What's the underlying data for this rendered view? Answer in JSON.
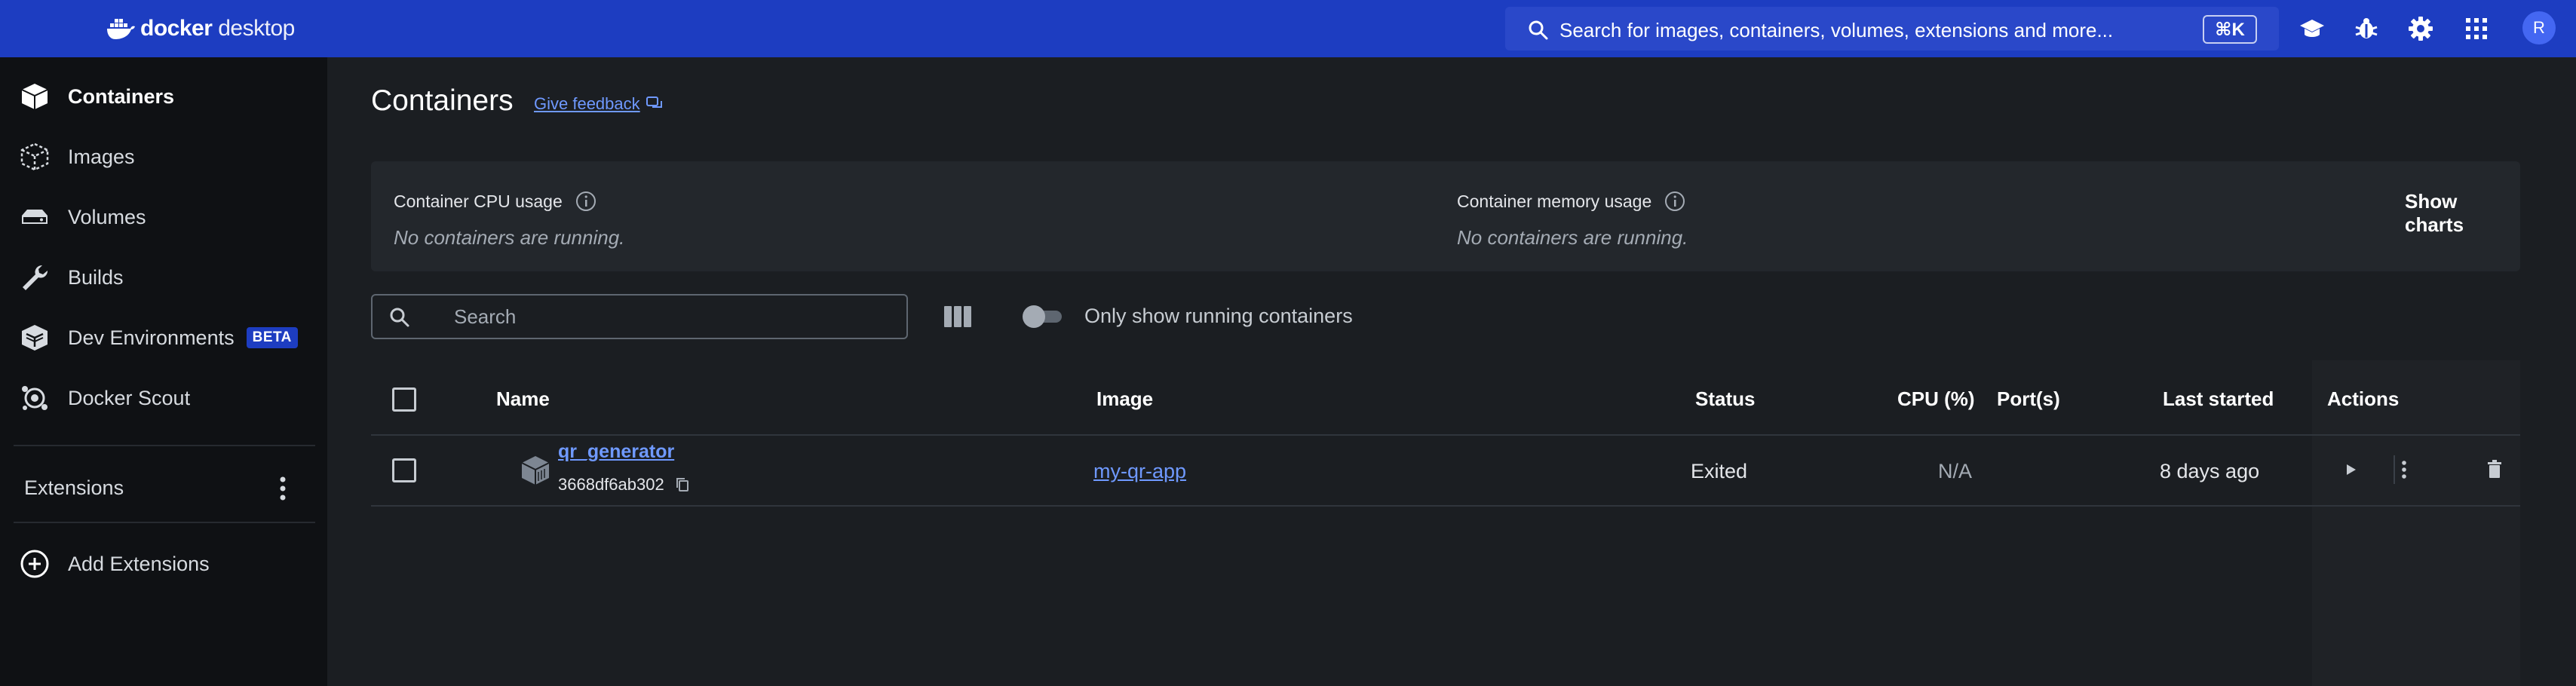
{
  "app": {
    "logo_bold": "docker",
    "logo_light": "desktop"
  },
  "topbar": {
    "search_placeholder": "Search for images, containers, volumes, extensions and more...",
    "shortcut": "⌘K",
    "icons": [
      "search-icon",
      "learning-center-icon",
      "troubleshoot-bug-icon",
      "settings-gear-icon",
      "apps-grid-icon"
    ],
    "avatar_initial": "R"
  },
  "sidebar": {
    "items": [
      {
        "label": "Containers",
        "icon": "containers-icon",
        "active": true
      },
      {
        "label": "Images",
        "icon": "images-icon",
        "active": false
      },
      {
        "label": "Volumes",
        "icon": "volumes-icon",
        "active": false
      },
      {
        "label": "Builds",
        "icon": "builds-wrench-icon",
        "active": false
      },
      {
        "label": "Dev Environments",
        "icon": "dev-environments-icon",
        "active": false,
        "badge": "BETA"
      },
      {
        "label": "Docker Scout",
        "icon": "docker-scout-icon",
        "active": false
      }
    ],
    "extensions_label": "Extensions",
    "add_extensions_label": "Add Extensions"
  },
  "main": {
    "title": "Containers",
    "feedback_label": "Give feedback",
    "stats": {
      "cpu_label": "Container CPU usage",
      "cpu_value": "No containers are running.",
      "memory_label": "Container memory usage",
      "memory_value": "No containers are running.",
      "show_charts_label": "Show charts"
    },
    "filter": {
      "search_placeholder": "Search",
      "toggle_label": "Only show running containers",
      "toggle_on": false
    },
    "table": {
      "headers": {
        "name": "Name",
        "image": "Image",
        "status": "Status",
        "cpu": "CPU (%)",
        "ports": "Port(s)",
        "last_started": "Last started",
        "actions": "Actions"
      },
      "rows": [
        {
          "name": "qr_generator",
          "id": "3668df6ab302",
          "image": "my-qr-app",
          "status": "Exited",
          "cpu": "N/A",
          "ports": "",
          "last_started": "8 days ago"
        }
      ]
    }
  },
  "colors": {
    "topbar": "#1d3dc1",
    "sidebar_bg": "#0f1114",
    "main_bg": "#1b1e22",
    "link": "#6f99ff",
    "beta_badge": "#1d3dc1"
  }
}
